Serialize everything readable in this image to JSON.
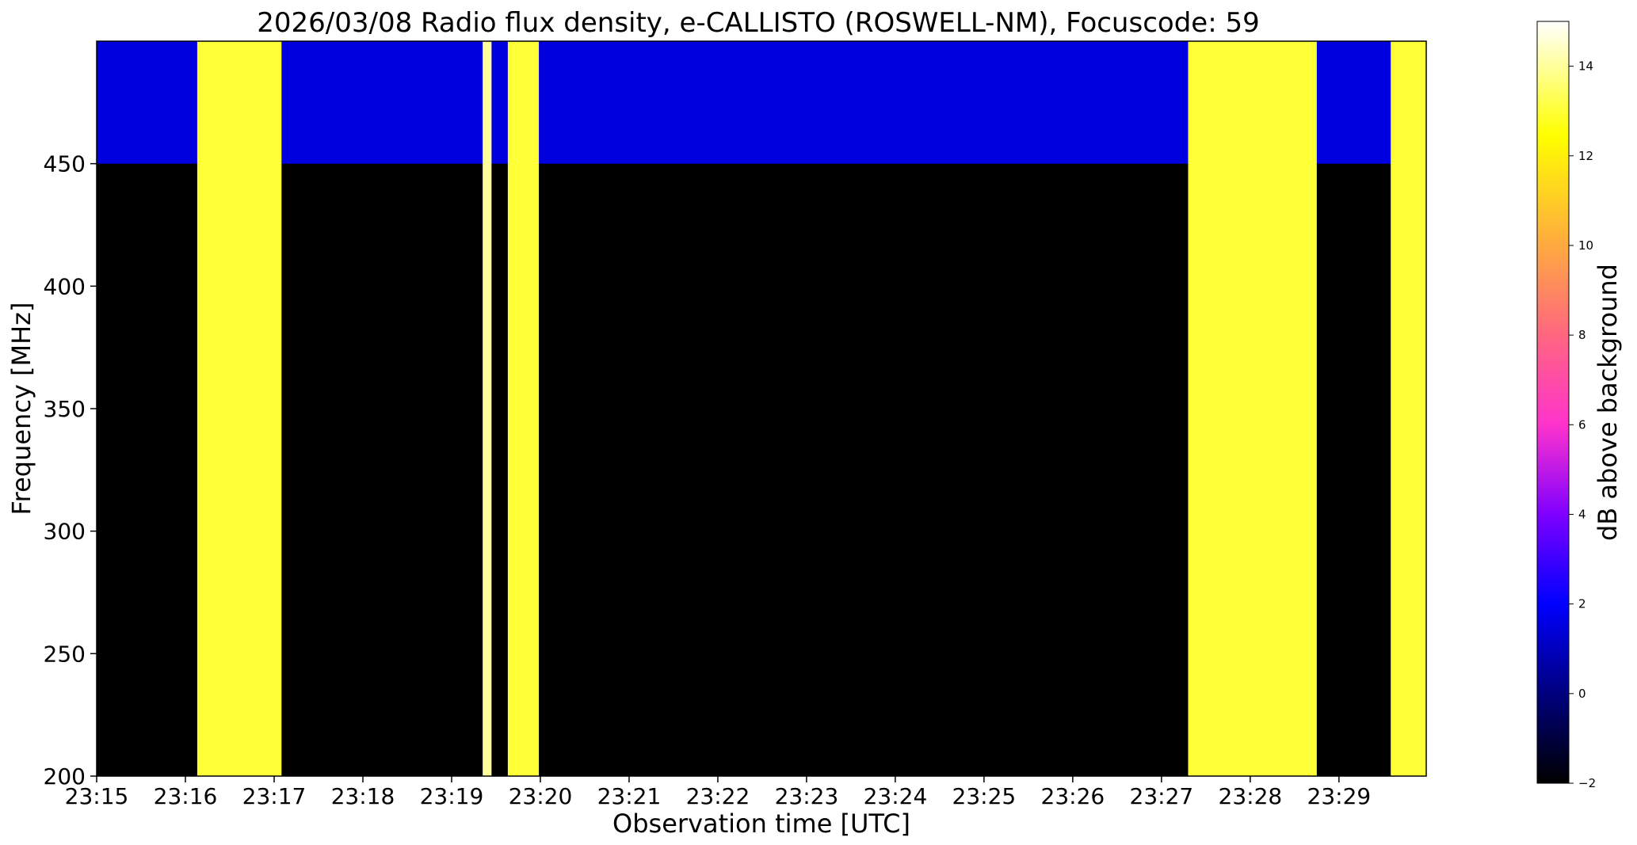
{
  "chart_data": {
    "type": "heatmap",
    "title": "2026/03/08  Radio flux density, e-CALLISTO (ROSWELL-NM), Focuscode: 59",
    "xlabel": "Observation time [UTC]",
    "ylabel": "Frequency [MHz]",
    "colorbar_label": "dB above background",
    "xlim": [
      "23:15:00",
      "23:29:59"
    ],
    "ylim": [
      200,
      500
    ],
    "x_ticks": [
      "23:15",
      "23:16",
      "23:17",
      "23:18",
      "23:19",
      "23:20",
      "23:21",
      "23:22",
      "23:23",
      "23:24",
      "23:25",
      "23:26",
      "23:27",
      "23:28",
      "23:29"
    ],
    "y_ticks": [
      200,
      250,
      300,
      350,
      400,
      450
    ],
    "color_range": [
      -2,
      15
    ],
    "colorbar_ticks": [
      -2,
      0,
      2,
      4,
      6,
      8,
      10,
      12,
      14
    ],
    "colormap": "gnuplot2",
    "grid": false,
    "bright_bands": [
      {
        "start": "23:16:08",
        "end": "23:17:05",
        "level_db": 13
      },
      {
        "start": "23:19:21",
        "end": "23:19:27",
        "level_db": 14
      },
      {
        "start": "23:19:38",
        "end": "23:19:59",
        "level_db": 13
      },
      {
        "start": "23:27:18",
        "end": "23:28:45",
        "level_db": 13
      },
      {
        "start": "23:29:35",
        "end": "23:29:59",
        "level_db": 13
      }
    ],
    "elevated_region": {
      "fmin": 450,
      "fmax": 500,
      "level_db": 1.5
    },
    "background_db": -2
  }
}
